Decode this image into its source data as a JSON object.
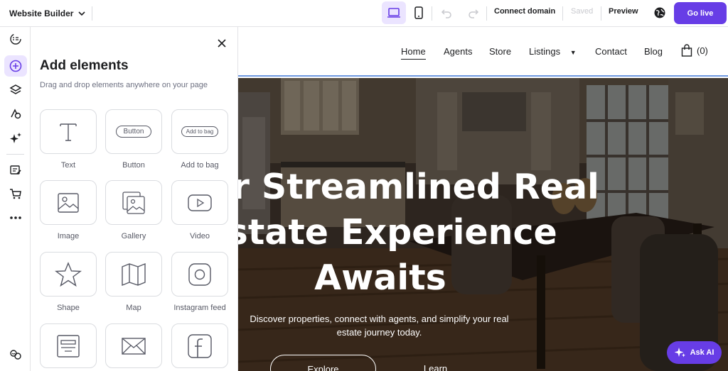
{
  "topbar": {
    "app_name": "Website Builder",
    "connect_domain": "Connect domain",
    "saved": "Saved",
    "preview": "Preview",
    "go_live": "Go live",
    "accent": "#673de6"
  },
  "panel": {
    "title": "Add elements",
    "subtitle": "Drag and drop elements anywhere on your page",
    "tiles": [
      {
        "label": "Text",
        "icon": "text-icon"
      },
      {
        "label": "Button",
        "icon": "button-icon",
        "preview": "Button"
      },
      {
        "label": "Add to bag",
        "icon": "add-to-bag-icon",
        "preview": "Add to bag"
      },
      {
        "label": "Image",
        "icon": "image-icon"
      },
      {
        "label": "Gallery",
        "icon": "gallery-icon"
      },
      {
        "label": "Video",
        "icon": "video-icon"
      },
      {
        "label": "Shape",
        "icon": "star-icon"
      },
      {
        "label": "Map",
        "icon": "map-icon"
      },
      {
        "label": "Instagram feed",
        "icon": "instagram-icon"
      },
      {
        "label": "",
        "icon": "form-icon"
      },
      {
        "label": "",
        "icon": "envelope-icon"
      },
      {
        "label": "",
        "icon": "facebook-icon"
      }
    ]
  },
  "site": {
    "nav": {
      "home": "Home",
      "agents": "Agents",
      "store": "Store",
      "listings": "Listings",
      "contact": "Contact",
      "blog": "Blog",
      "cart_count": "(0)"
    },
    "hero": {
      "title": "Your Streamlined Real Estate Experience Awaits",
      "text": "Discover properties, connect with agents, and simplify your real estate journey today.",
      "btn_explore": "Explore",
      "btn_learn": "Learn"
    }
  },
  "ask_ai": "Ask AI"
}
